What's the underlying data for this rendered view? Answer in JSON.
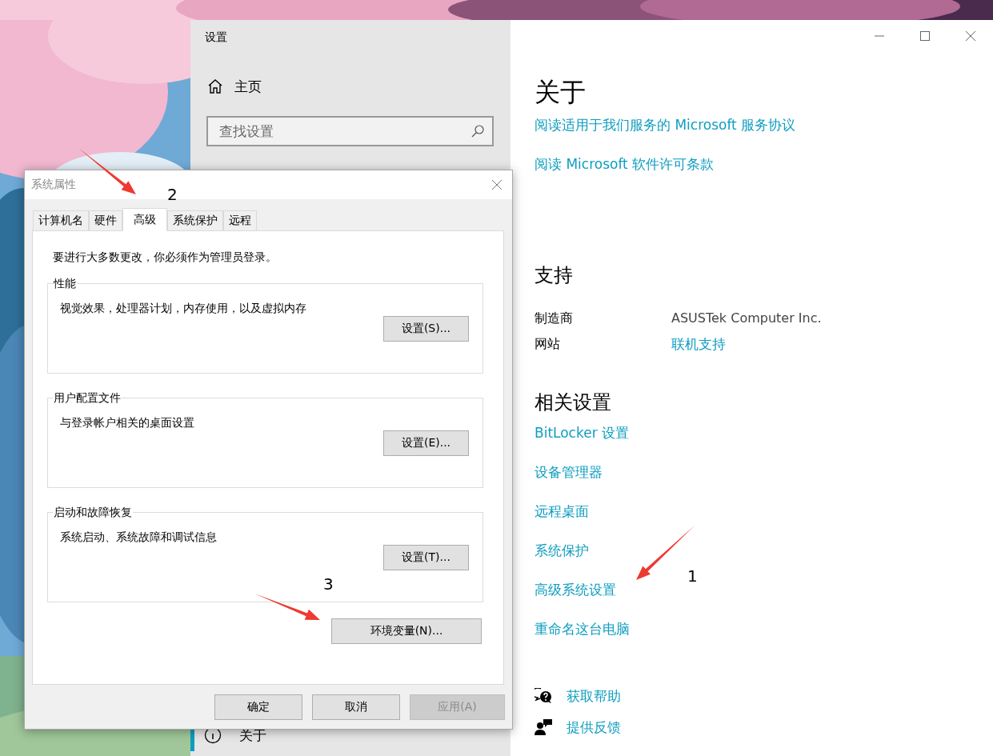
{
  "settings_window": {
    "title": "设置",
    "sidebar": {
      "home": "主页",
      "search": {
        "placeholder": "查找设置"
      },
      "items": [
        {
          "label": "关于",
          "selected": true
        }
      ]
    },
    "content": {
      "title": "关于",
      "links": [
        "阅读适用于我们服务的 Microsoft 服务协议",
        "阅读 Microsoft 软件许可条款"
      ],
      "support": {
        "heading": "支持",
        "rows": [
          {
            "kind": "text",
            "label": "制造商",
            "value": "ASUSTek Computer Inc."
          },
          {
            "kind": "link",
            "label": "网站",
            "value": "联机支持"
          }
        ]
      },
      "related": {
        "heading": "相关设置",
        "links": [
          "BitLocker 设置",
          "设备管理器",
          "远程桌面",
          "系统保护",
          "高级系统设置",
          "重命名这台电脑"
        ]
      },
      "help": [
        {
          "kind": "help",
          "label": "获取帮助"
        },
        {
          "kind": "feedback",
          "label": "提供反馈"
        }
      ]
    }
  },
  "dialog": {
    "title": "系统属性",
    "tabs": [
      {
        "label": "计算机名",
        "selected": false
      },
      {
        "label": "硬件",
        "selected": false
      },
      {
        "label": "高级",
        "selected": true
      },
      {
        "label": "系统保护",
        "selected": false
      },
      {
        "label": "远程",
        "selected": false
      }
    ],
    "notice": "要进行大多数更改，你必须作为管理员登录。",
    "groups": [
      {
        "title": "性能",
        "description": "视觉效果，处理器计划，内存使用，以及虚拟内存",
        "button": "设置(S)..."
      },
      {
        "title": "用户配置文件",
        "description": "与登录帐户相关的桌面设置",
        "button": "设置(E)..."
      },
      {
        "title": "启动和故障恢复",
        "description": "系统启动、系统故障和调试信息",
        "button": "设置(T)..."
      }
    ],
    "env_button": "环境变量(N)...",
    "buttons": [
      {
        "label": "确定",
        "disabled": false
      },
      {
        "label": "取消",
        "disabled": false
      },
      {
        "label": "应用(A)",
        "disabled": true
      }
    ]
  },
  "annotations": [
    {
      "label": "2"
    },
    {
      "label": "3"
    },
    {
      "label": "1"
    }
  ]
}
